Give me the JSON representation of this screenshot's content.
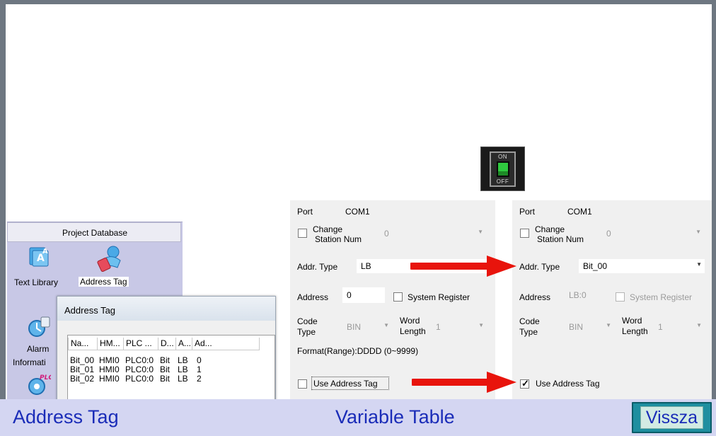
{
  "toggle": {
    "on_label": "ON",
    "off_label": "OFF"
  },
  "project_database": {
    "title": "Project Database",
    "items": [
      {
        "label": "Text Library",
        "icon": "text-library-icon"
      },
      {
        "label": "Address Tag",
        "icon": "address-tag-icon",
        "selected": true
      },
      {
        "label": "Alarm",
        "icon": "alarm-icon"
      },
      {
        "label": "Informati",
        "icon": ""
      },
      {
        "label": "PLC",
        "icon": "plc-icon"
      }
    ]
  },
  "address_tag_dialog": {
    "title": "Address Tag",
    "columns": [
      "Na...",
      "HM...",
      "PLC ...",
      "D...",
      "A...",
      "Ad..."
    ],
    "rows": [
      [
        "Bit_00",
        "HMI0",
        "PLC0:0",
        "Bit",
        "LB",
        "0"
      ],
      [
        "Bit_01",
        "HMI0",
        "PLC0:0",
        "Bit",
        "LB",
        "1"
      ],
      [
        "Bit_02",
        "HMI0",
        "PLC0:0",
        "Bit",
        "LB",
        "2"
      ]
    ]
  },
  "panel_before": {
    "port_label": "Port",
    "port_value": "COM1",
    "change_station_label": "Change\nStation Num",
    "change_station_line1": "Change",
    "change_station_line2": "Station Num",
    "station_value": "0",
    "addr_type_label": "Addr. Type",
    "addr_type_value": "LB",
    "address_label": "Address",
    "address_value": "0",
    "system_register_label": "System Register",
    "code_type_line1": "Code",
    "code_type_line2": "Type",
    "code_type_value": "BIN",
    "word_length_line1": "Word",
    "word_length_line2": "Length",
    "word_length_value": "1",
    "format_text": "Format(Range):DDDD (0~9999)",
    "use_address_tag_label": "Use Address Tag",
    "use_address_tag_checked": false
  },
  "panel_after": {
    "port_label": "Port",
    "port_value": "COM1",
    "change_station_line1": "Change",
    "change_station_line2": "Station Num",
    "station_value": "0",
    "addr_type_label": "Addr. Type",
    "addr_type_value": "Bit_00",
    "address_label": "Address",
    "address_value": "LB:0",
    "system_register_label": "System Register",
    "code_type_line1": "Code",
    "code_type_line2": "Type",
    "code_type_value": "BIN",
    "word_length_line1": "Word",
    "word_length_line2": "Length",
    "word_length_value": "1",
    "use_address_tag_label": "Use Address Tag",
    "use_address_tag_checked": true
  },
  "bottom_bar": {
    "left_label": "Address Tag",
    "center_label": "Variable Table",
    "back_button": "Vissza"
  },
  "colors": {
    "arrow": "#e8140c",
    "bottom_bar_bg": "#d4d6f2",
    "bottom_text": "#1a2cb8",
    "toggle_green": "#2fc93f",
    "project_db_bg": "#c8c8e6"
  }
}
